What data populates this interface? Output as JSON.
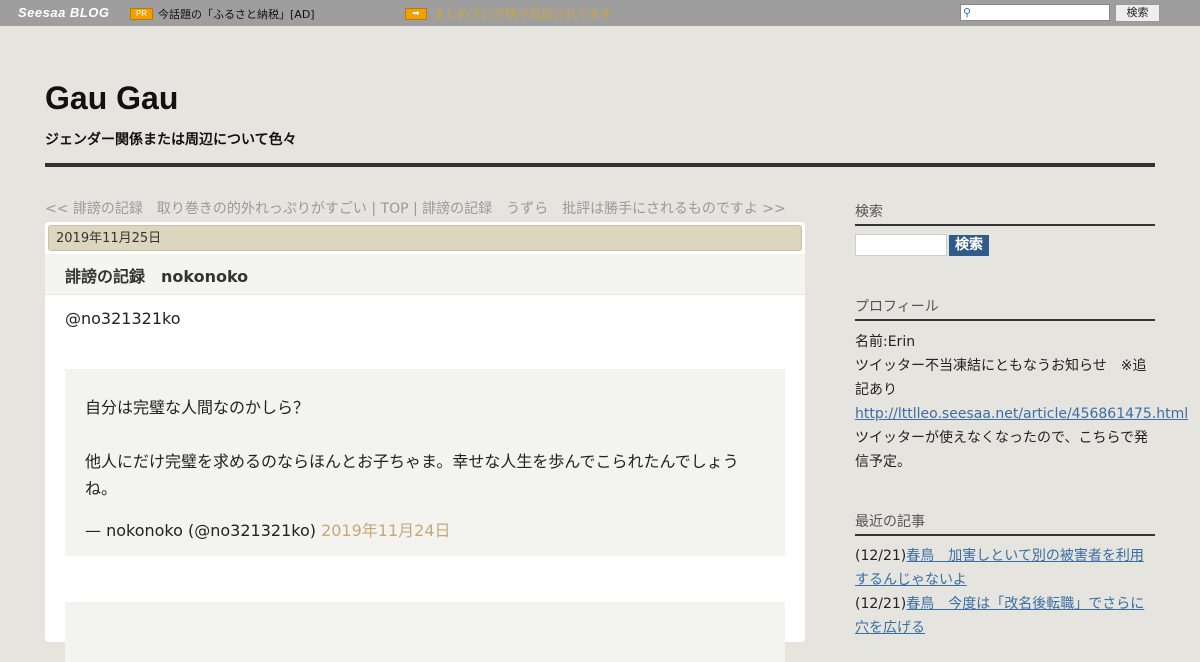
{
  "topbar": {
    "logo": "Seesaa BLOG",
    "pr_badge": "PR",
    "pr_text": "今話題の「ふるさと納税」[AD]",
    "notice": "まとめブログ続々追加されてます",
    "search_button": "検索"
  },
  "header": {
    "title": "Gau Gau",
    "description": "ジェンダー関係または周辺について色々"
  },
  "pager": "<< 誹謗の記録　取り巻きの的外れっぷりがすごい | TOP | 誹謗の記録　うずら　批評は勝手にされるものですよ >>",
  "post": {
    "date": "2019年11月25日",
    "title": "誹謗の記録　nokonoko",
    "handle": "@no321321ko",
    "quote": {
      "line1": "自分は完璧な人間なのかしら？",
      "line2": "他人にだけ完璧を求めるのならほんとお子ちゃま。幸せな人生を歩んでこられたんでしょうね。",
      "attribution": "— nokonoko (@no321321ko) ",
      "date": "2019年11月24日"
    }
  },
  "sidebar": {
    "search_heading": "検索",
    "search_button": "検索",
    "profile_heading": "プロフィール",
    "profile_name": "名前:Erin",
    "profile_notice": "ツイッター不当凍結にともなうお知らせ　※追記あり",
    "profile_link": "http://lttlleo.seesaa.net/article/456861475.html",
    "profile_note": "ツイッターが使えなくなったので、こちらで発信予定。",
    "recent_heading": "最近の記事",
    "recent": [
      {
        "date": "(12/21)",
        "title": "春鳥　加害しといて別の被害者を利用するんじゃないよ"
      },
      {
        "date": "(12/21)",
        "title": "春鳥　今度は「改名後転職」でさらに穴を広げる"
      }
    ]
  }
}
